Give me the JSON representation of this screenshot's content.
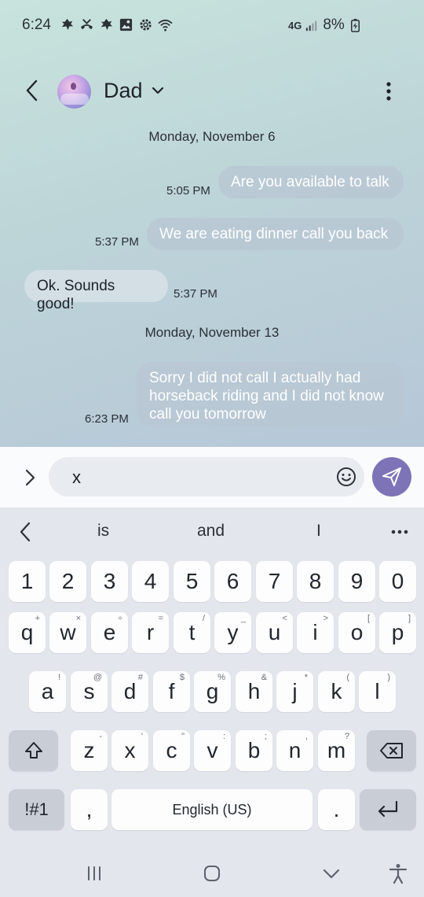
{
  "status_bar": {
    "time": "6:24",
    "left_icons": [
      "leaf-icon",
      "missed-call-icon",
      "leaf-icon",
      "gallery-icon",
      "settings-icon",
      "wifi-icon"
    ],
    "network": "4G",
    "battery": "8%"
  },
  "header": {
    "contact_name": "Dad",
    "back_icon": "back-arrow-icon",
    "more_icon": "more-vertical-icon"
  },
  "conversation": {
    "date_1": "Monday, November 6",
    "msg_1": {
      "text": "Are you available to talk",
      "time": "5:05 PM",
      "direction": "outgoing"
    },
    "msg_2": {
      "text": "We are eating dinner call you back",
      "time": "5:37 PM",
      "direction": "outgoing"
    },
    "msg_3": {
      "text": "Ok. Sounds good!",
      "time": "5:37 PM",
      "direction": "incoming"
    },
    "date_2": "Monday, November 13",
    "msg_4": {
      "line_1": "Sorry I did not call I actually had",
      "line_2": "horseback riding and I did not know",
      "line_3": "call you tomorrow",
      "time": "6:23 PM",
      "direction": "outgoing"
    }
  },
  "composer": {
    "value": "x",
    "send_color": "#7d73b6"
  },
  "keyboard": {
    "suggestions": [
      "is",
      "and",
      "I"
    ],
    "row_numbers": [
      "1",
      "2",
      "3",
      "4",
      "5",
      "6",
      "7",
      "8",
      "9",
      "0"
    ],
    "row_1": [
      {
        "k": "q",
        "s": "+"
      },
      {
        "k": "w",
        "s": "×"
      },
      {
        "k": "e",
        "s": "÷"
      },
      {
        "k": "r",
        "s": "="
      },
      {
        "k": "t",
        "s": "/"
      },
      {
        "k": "y",
        "s": "_"
      },
      {
        "k": "u",
        "s": "<"
      },
      {
        "k": "i",
        "s": ">"
      },
      {
        "k": "o",
        "s": "["
      },
      {
        "k": "p",
        "s": "]"
      }
    ],
    "row_2": [
      {
        "k": "a",
        "s": "!"
      },
      {
        "k": "s",
        "s": "@"
      },
      {
        "k": "d",
        "s": "#"
      },
      {
        "k": "f",
        "s": "$"
      },
      {
        "k": "g",
        "s": "%"
      },
      {
        "k": "h",
        "s": "&"
      },
      {
        "k": "j",
        "s": "*"
      },
      {
        "k": "k",
        "s": "("
      },
      {
        "k": "l",
        "s": ")"
      }
    ],
    "row_3": [
      {
        "k": "z",
        "s": "-"
      },
      {
        "k": "x",
        "s": "'"
      },
      {
        "k": "c",
        "s": "\""
      },
      {
        "k": "v",
        "s": ":"
      },
      {
        "k": "b",
        "s": ";"
      },
      {
        "k": "n",
        "s": ","
      },
      {
        "k": "m",
        "s": "?"
      }
    ],
    "symbols_key": "!#1",
    "comma_key": ",",
    "space_key": "English (US)",
    "period_key": "."
  }
}
